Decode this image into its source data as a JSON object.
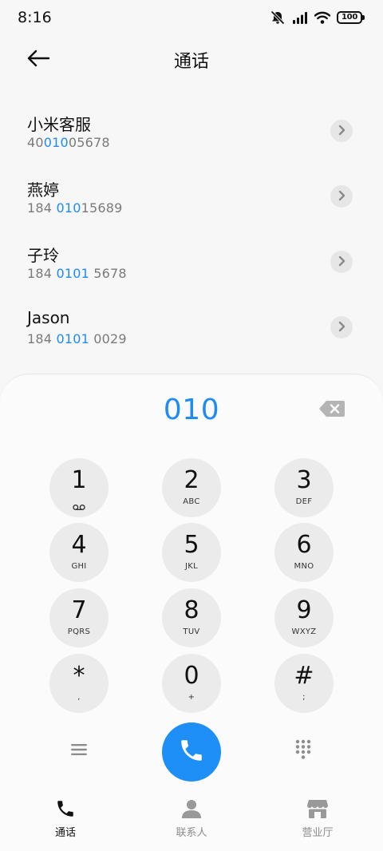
{
  "status_bar": {
    "time": "8:16",
    "icons": [
      "mute-icon",
      "signal-icon",
      "wifi-icon",
      "battery-icon"
    ],
    "battery": "100"
  },
  "header": {
    "title": "通话",
    "back_icon": "arrow-left-icon"
  },
  "contacts": [
    {
      "name": "小米客服",
      "number_prefix": "40",
      "number_match": "010",
      "number_suffix": "05678"
    },
    {
      "name": "燕婷",
      "number_prefix": "184 ",
      "number_match": "010",
      "number_suffix": "15689"
    },
    {
      "name": "子玲",
      "number_prefix": "184 ",
      "number_match": "0101",
      "number_suffix": " 5678"
    },
    {
      "name": "Jason",
      "number_prefix": "184 ",
      "number_match": "0101",
      "number_suffix": " 0029"
    }
  ],
  "dialpad": {
    "input_value": "010",
    "keys": [
      {
        "digit": "1",
        "letters": ""
      },
      {
        "digit": "2",
        "letters": "ABC"
      },
      {
        "digit": "3",
        "letters": "DEF"
      },
      {
        "digit": "4",
        "letters": "GHI"
      },
      {
        "digit": "5",
        "letters": "JKL"
      },
      {
        "digit": "6",
        "letters": "MNO"
      },
      {
        "digit": "7",
        "letters": "PQRS"
      },
      {
        "digit": "8",
        "letters": "TUV"
      },
      {
        "digit": "9",
        "letters": "WXYZ"
      },
      {
        "digit": "*",
        "letters": ","
      },
      {
        "digit": "0",
        "letters": "+"
      },
      {
        "digit": "#",
        "letters": ";"
      }
    ]
  },
  "bottom_nav": [
    {
      "label": "通话",
      "icon": "phone-icon",
      "active": true
    },
    {
      "label": "联系人",
      "icon": "person-icon",
      "active": false
    },
    {
      "label": "营业厅",
      "icon": "store-icon",
      "active": false
    }
  ],
  "colors": {
    "accent": "#1e8cf0",
    "call_button": "#1e8ff7",
    "key_background": "#ebebeb",
    "panel_background": "#fbfbfb",
    "page_background": "#f7f7f7"
  }
}
